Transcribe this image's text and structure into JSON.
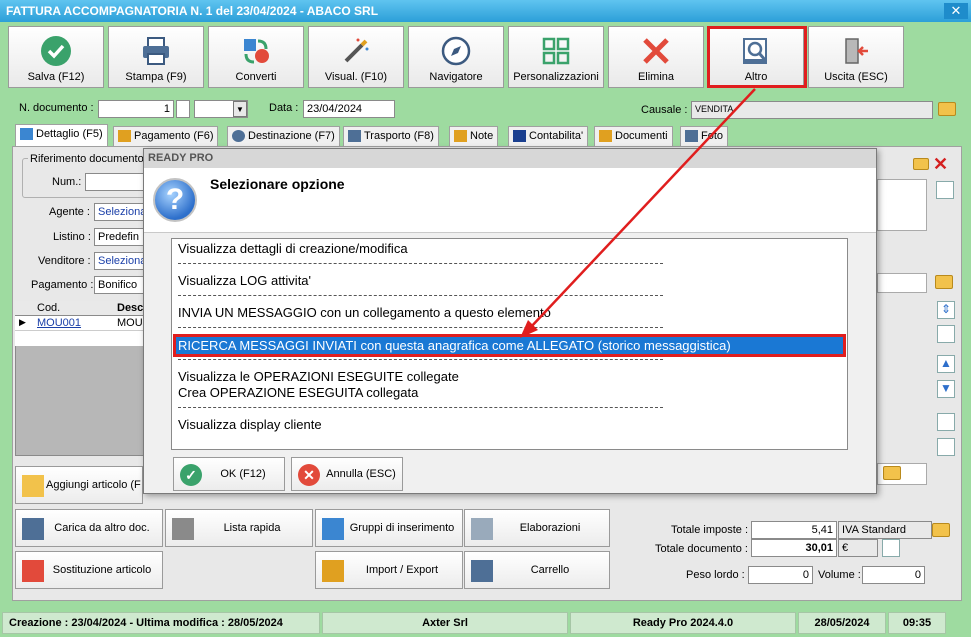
{
  "window": {
    "title": "FATTURA ACCOMPAGNATORIA N. 1 del 23/04/2024 - ABACO SRL",
    "close": "✕"
  },
  "toolbar": [
    {
      "label": "Salva (F12)",
      "icon": "check-circle-icon"
    },
    {
      "label": "Stampa (F9)",
      "icon": "printer-icon"
    },
    {
      "label": "Converti",
      "icon": "convert-icon"
    },
    {
      "label": "Visual. (F10)",
      "icon": "magic-wand-icon"
    },
    {
      "label": "Navigatore",
      "icon": "compass-icon"
    },
    {
      "label": "Personalizzazioni",
      "icon": "grid-icon"
    },
    {
      "label": "Elimina",
      "icon": "delete-x-icon"
    },
    {
      "label": "Altro",
      "icon": "magnifier-doc-icon"
    },
    {
      "label": "Uscita (ESC)",
      "icon": "exit-door-icon"
    }
  ],
  "header": {
    "ndoc_label": "N. documento :",
    "ndoc_value": "1",
    "data_label": "Data :",
    "data_value": "23/04/2024",
    "causale_label": "Causale :",
    "causale_value": "VENDITA"
  },
  "tabs": [
    {
      "label": "Dettaglio (F5)"
    },
    {
      "label": "Pagamento (F6)"
    },
    {
      "label": "Destinazione (F7)"
    },
    {
      "label": "Trasporto (F8)"
    },
    {
      "label": "Note"
    },
    {
      "label": "Contabilita'"
    },
    {
      "label": "Documenti"
    },
    {
      "label": "Foto"
    }
  ],
  "detail": {
    "rif_label": "Riferimento documento",
    "num_label": "Num.:",
    "agente_label": "Agente :",
    "agente_value": "Seleziona",
    "listino_label": "Listino :",
    "listino_value": "Predefin",
    "venditore_label": "Venditore :",
    "venditore_value": "Seleziona",
    "pagamento_label": "Pagamento :",
    "pagamento_value": "Bonifico",
    "grid_col_cod": "Cod.",
    "grid_col_desc": "Desc",
    "grid_row_cod": "MOU001",
    "grid_row_desc": "MOUS"
  },
  "bottom_buttons": {
    "aggiungi": "Aggiungi articolo (F",
    "carica": "Carica da altro doc.",
    "lista": "Lista rapida",
    "gruppi": "Gruppi di inserimento",
    "elaborazioni": "Elaborazioni",
    "sostituzione": "Sostituzione articolo",
    "import": "Import / Export",
    "carrello": "Carrello"
  },
  "totals": {
    "imposte_label": "Totale imposte :",
    "imposte_value": "5,41",
    "iva_value": "IVA Standard",
    "documento_label": "Totale documento :",
    "documento_value": "30,01",
    "currency": "€",
    "peso_lordo_label": "Peso lordo :",
    "peso_lordo_value": "0",
    "volume_label": "Volume :",
    "volume_value": "0"
  },
  "status": {
    "creazione": "Creazione : 23/04/2024 - Ultima modifica : 28/05/2024",
    "company": "Axter Srl",
    "version": "Ready Pro 2024.4.0",
    "date": "28/05/2024",
    "time": "09:35"
  },
  "dialog": {
    "title": "READY PRO",
    "heading": "Selezionare opzione",
    "options": [
      "Visualizza dettagli di creazione/modifica",
      "Visualizza LOG attivita'",
      "INVIA UN MESSAGGIO con un collegamento a questo elemento",
      "RICERCA MESSAGGI INVIATI con questa anagrafica come ALLEGATO (storico messaggistica)",
      "Visualizza le OPERAZIONI ESEGUITE collegate",
      "Crea OPERAZIONE ESEGUITA collegata",
      "Visualizza display cliente"
    ],
    "selected_index": 3,
    "ok_label": "OK (F12)",
    "cancel_label": "Annulla (ESC)"
  },
  "colors": {
    "accent": "#9edba0",
    "selection": "#1a78d4",
    "annotation": "#e01e1e"
  }
}
